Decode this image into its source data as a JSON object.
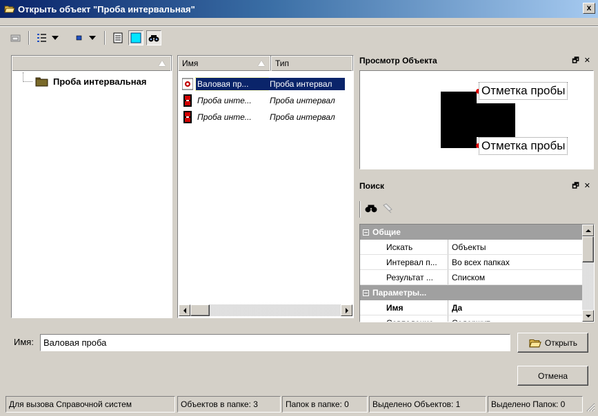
{
  "window": {
    "title": "Открыть объект \"Проба интервальная\"",
    "close_label": "x"
  },
  "toolbar": {
    "buttons": [
      "up-folder-icon",
      "view-list-icon",
      "view-small-icon",
      "details-icon",
      "preview-icon",
      "search-icon"
    ]
  },
  "tree": {
    "root_label": "Проба интервальная"
  },
  "list": {
    "columns": [
      "Имя",
      "Тип"
    ],
    "rows": [
      {
        "name": "Валовая пр...",
        "type": "Проба интервал",
        "selected": true,
        "italic": false
      },
      {
        "name": "Проба инте...",
        "type": "Проба интервал",
        "selected": false,
        "italic": true
      },
      {
        "name": "Проба инте...",
        "type": "Проба интервал",
        "selected": false,
        "italic": true
      }
    ]
  },
  "preview": {
    "title": "Просмотр Объекта",
    "pin_label": "🗗 ✕",
    "marks": [
      "Отметка пробы",
      "Отметка пробы"
    ]
  },
  "search": {
    "title": "Поиск",
    "pin_label": "🗗 ✕",
    "groups": [
      {
        "label": "Общие",
        "rows": [
          {
            "key": "Искать",
            "value": "Объекты"
          },
          {
            "key": "Интервал п...",
            "value": "Во всех папках"
          },
          {
            "key": "Результат ...",
            "value": "Списком"
          }
        ]
      },
      {
        "label": "Параметры...",
        "rows": [
          {
            "key": "Имя",
            "value": "Да",
            "bold": true
          },
          {
            "key": "Совпадение",
            "value": "Содержит"
          }
        ]
      }
    ]
  },
  "name_field": {
    "label": "Имя:",
    "value": "Валовая проба"
  },
  "buttons": {
    "open": "Открыть",
    "cancel": "Отмена"
  },
  "status": {
    "help": "Для вызова Справочной систем",
    "objects_in_folder": "Объектов в папке: 3",
    "folders_in_folder": "Папок в папке: 0",
    "selected_objects": "Выделено Объектов: 1",
    "selected_folders": "Выделено Папок: 0"
  },
  "colors": {
    "selection": "#0a246a",
    "window_bg": "#d4d0c8",
    "group_header": "#a0a0a0"
  }
}
